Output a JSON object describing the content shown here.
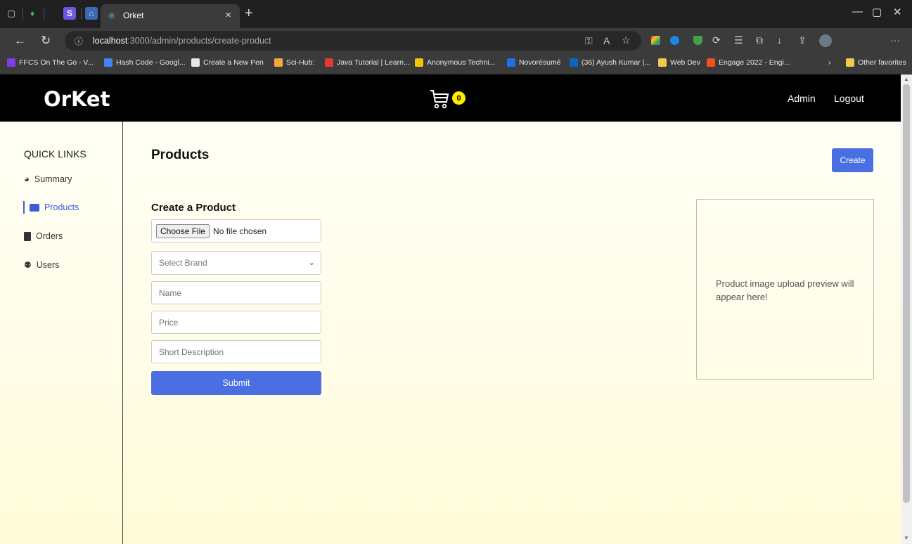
{
  "browser": {
    "tab_title": "Orket",
    "url_host": "localhost",
    "url_path": ":3000/admin/products/create-product",
    "bookmarks": [
      {
        "label": "FFCS On The Go - V...",
        "color": "#7b3fe4"
      },
      {
        "label": "Hash Code - Googl...",
        "color": "#4285f4"
      },
      {
        "label": "Create a New Pen",
        "color": "#e6e6e6"
      },
      {
        "label": "Sci-Hub:",
        "color": "#f4a83a"
      },
      {
        "label": "Java Tutorial | Learn...",
        "color": "#e53935"
      },
      {
        "label": "Anonymous Techni...",
        "color": "#f5c400"
      },
      {
        "label": "Novorésumé",
        "color": "#1a73e8"
      },
      {
        "label": "(36) Ayush Kumar |...",
        "color": "#0a66c2"
      },
      {
        "label": "Web Dev",
        "color": "#f2c94c"
      },
      {
        "label": "Engage 2022 - Engi...",
        "color": "#f25022"
      }
    ],
    "other_favorites": "Other favorites"
  },
  "header": {
    "logo": "OrKet",
    "cart_count": "0",
    "admin_label": "Admin",
    "logout_label": "Logout"
  },
  "sidebar": {
    "title": "QUICK LINKS",
    "items": [
      {
        "label": "Summary",
        "icon": "gauge-icon"
      },
      {
        "label": "Products",
        "icon": "store-icon",
        "active": true
      },
      {
        "label": "Orders",
        "icon": "clipboard-icon"
      },
      {
        "label": "Users",
        "icon": "users-icon"
      }
    ]
  },
  "main": {
    "title": "Products",
    "create_label": "Create",
    "form_title": "Create a Product",
    "file_button": "Choose File",
    "file_status": "No file chosen",
    "brand_placeholder": "Select Brand",
    "name_placeholder": "Name",
    "price_placeholder": "Price",
    "description_placeholder": "Short Description",
    "submit_label": "Submit",
    "preview_text": "Product image upload preview will appear here!"
  },
  "colors": {
    "accent": "#4a6fe3",
    "header_bg": "#000000",
    "badge": "#ffeb00"
  }
}
